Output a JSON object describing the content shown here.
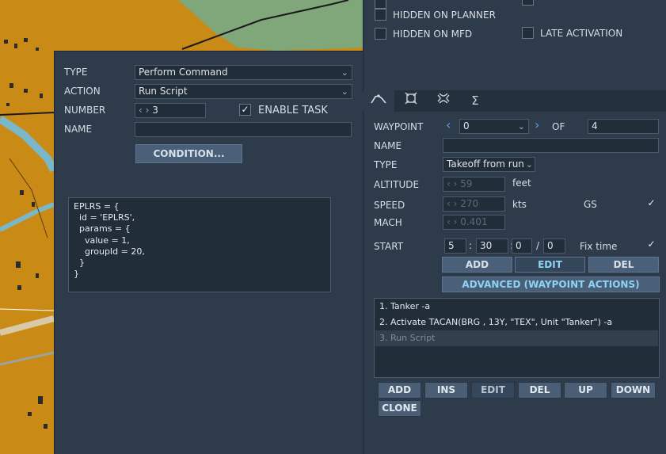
{
  "left_panel": {
    "type_label": "TYPE",
    "type_value": "Perform Command",
    "action_label": "ACTION",
    "action_value": "Run Script",
    "number_label": "NUMBER",
    "number_value": "3",
    "enable_task_label": "ENABLE TASK",
    "enable_task_checked": "✓",
    "name_label": "NAME",
    "name_value": "",
    "condition_button": "CONDITION...",
    "script_text": "EPLRS = {\n  id = 'EPLRS',\n  params = {\n    value = 1,\n    groupId = 20,\n  }\n}"
  },
  "top_flags": {
    "hidden_on_planner": "HIDDEN ON PLANNER",
    "hidden_on_mfd": "HIDDEN ON MFD",
    "late_activation": "LATE ACTIVATION"
  },
  "tabs": [
    {
      "icon": "route-icon"
    },
    {
      "icon": "target-icon"
    },
    {
      "icon": "payload-icon"
    },
    {
      "icon": "summary-icon"
    }
  ],
  "waypoint": {
    "label": "WAYPOINT",
    "value": "0",
    "of_label": "OF",
    "of_value": "4",
    "name_label": "NAME",
    "name_value": "",
    "type_label": "TYPE",
    "type_value": "Takeoff from run",
    "altitude_label": "ALTITUDE",
    "altitude_value": "59",
    "altitude_unit": "feet",
    "speed_label": "SPEED",
    "speed_value": "270",
    "speed_unit": "kts",
    "gs_label": "GS",
    "gs_checked": "✓",
    "mach_label": "MACH",
    "mach_value": "0.401",
    "start_label": "START",
    "start_day": "5",
    "start_hour": "30",
    "start_min": "0",
    "start_sec": "0",
    "start_sep1": ":",
    "start_sep2": ":",
    "start_sep3": "/",
    "fix_time_label": "Fix time",
    "fix_time_checked": "✓",
    "add_button": "ADD",
    "edit_button": "EDIT",
    "del_button": "DEL",
    "advanced_button": "ADVANCED (WAYPOINT ACTIONS)"
  },
  "actions": [
    {
      "text": "1. Tanker -a"
    },
    {
      "text": "2. Activate TACAN(BRG , 13Y, \"TEX\", Unit \"Tanker\")   -a"
    },
    {
      "text": "3. Run Script"
    }
  ],
  "action_buttons": {
    "add": "ADD",
    "ins": "INS",
    "edit": "EDIT",
    "del": "DEL",
    "up": "UP",
    "down": "DOWN",
    "clone": "CLONE"
  },
  "colors": {
    "panel_bg": "#2e3b4b",
    "field_bg": "#222d3a",
    "button_bg": "#4a6079",
    "accent_text": "#8fd3f4",
    "map_land": "#c98a16",
    "map_green": "#7fa77a",
    "map_water": "#7ab7c8"
  }
}
